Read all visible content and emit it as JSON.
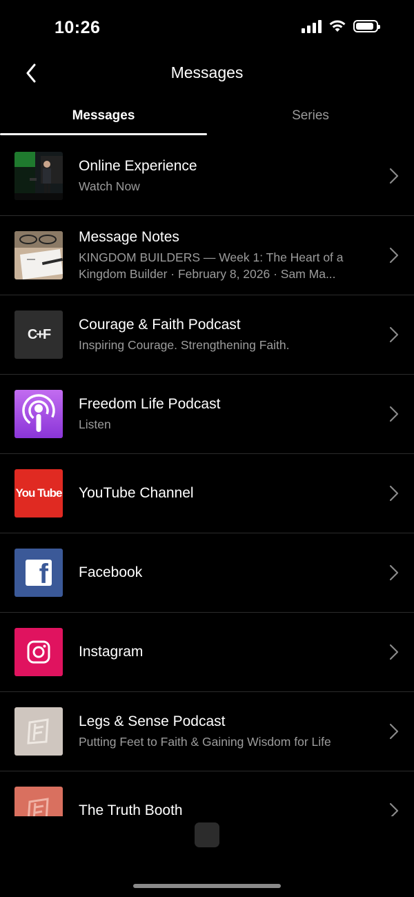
{
  "status_bar": {
    "time": "10:26",
    "battery_level": 0.9
  },
  "nav": {
    "title": "Messages",
    "back_icon": "chevron-left-icon"
  },
  "tabs": [
    {
      "label": "Messages",
      "active": true
    },
    {
      "label": "Series",
      "active": false
    }
  ],
  "items": [
    {
      "title": "Online Experience",
      "subtitle": "Watch Now",
      "icon": "video-thumbnail"
    },
    {
      "title": "Message Notes",
      "subtitle": "KINGDOM BUILDERS — Week 1: The Heart of a Kingdom Builder · February 8, 2026 · Sam Ma...",
      "icon": "notes-thumbnail"
    },
    {
      "title": "Courage & Faith Podcast",
      "subtitle": "Inspiring Courage. Strengthening Faith.",
      "icon": "cf-logo",
      "logo_text": "C+F"
    },
    {
      "title": "Freedom Life Podcast",
      "subtitle": "Listen",
      "icon": "podcast-icon"
    },
    {
      "title": "YouTube Channel",
      "subtitle": "",
      "icon": "youtube-logo",
      "logo_text": "You Tube"
    },
    {
      "title": "Facebook",
      "subtitle": "",
      "icon": "facebook-logo",
      "logo_text": "f"
    },
    {
      "title": "Instagram",
      "subtitle": "",
      "icon": "instagram-logo"
    },
    {
      "title": "Legs & Sense Podcast",
      "subtitle": "Putting Feet to Faith & Gaining Wisdom for Life",
      "icon": "church-logo"
    },
    {
      "title": "The Truth Booth",
      "subtitle": "",
      "icon": "church-logo-red"
    }
  ],
  "colors": {
    "background": "#000000",
    "youtube": "#e02a22",
    "facebook": "#3b5998",
    "instagram": "#e0135f",
    "podcast_purple": "#a24ee0"
  }
}
